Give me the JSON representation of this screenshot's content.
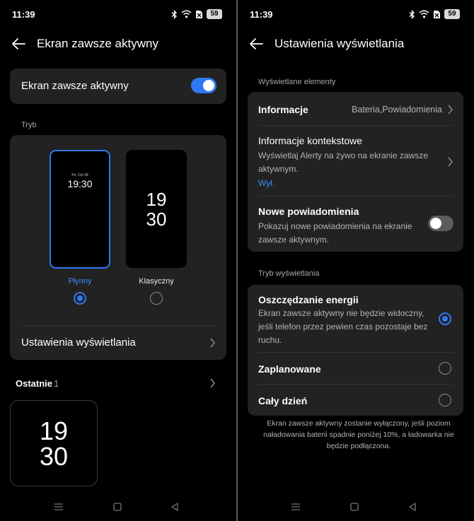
{
  "colors": {
    "accent": "#2f79f2",
    "card": "#222223",
    "background": "#000000",
    "link": "#3d8bf5"
  },
  "left": {
    "status": {
      "time": "11:39",
      "battery": "59"
    },
    "header": {
      "title": "Ekran zawsze aktywny"
    },
    "main_toggle": {
      "label": "Ekran zawsze aktywny",
      "state": "on"
    },
    "mode_section_label": "Tryb",
    "modes": [
      {
        "name": "Płynny",
        "preview_date": "Fri, Oct 28",
        "preview_time": "19:30",
        "selected": true
      },
      {
        "name": "Klasyczny",
        "preview_hour": "19",
        "preview_minute": "30",
        "selected": false
      }
    ],
    "display_settings_label": "Ustawienia wyświetlania",
    "recent": {
      "label": "Ostatnie",
      "count": "1",
      "preview_hour": "19",
      "preview_minute": "30"
    }
  },
  "right": {
    "status": {
      "time": "11:39",
      "battery": "59"
    },
    "header": {
      "title": "Ustawienia wyświetlania"
    },
    "displayed_section_label": "Wyświetlane elementy",
    "info": {
      "title": "Informacje",
      "value": "Bateria,Powiadomienia"
    },
    "contextual": {
      "title": "Informacje kontekstowe",
      "desc": "Wyświetlaj Alerty na żywo na ekranie zawsze aktywnym.",
      "state": "Wył."
    },
    "new_notifications": {
      "title": "Nowe powiadomienia",
      "desc": "Pokazuj nowe powiadomienia na ekranie zawsze aktywnym.",
      "state": "off"
    },
    "display_mode_section_label": "Tryb wyświetlania",
    "modes": [
      {
        "title": "Oszczędzanie energii",
        "desc": "Ekran zawsze aktywny nie będzie widoczny, jeśli telefon przez pewien czas pozostaje bez ruchu.",
        "selected": true
      },
      {
        "title": "Zaplanowane",
        "selected": false
      },
      {
        "title": "Cały dzień",
        "selected": false
      }
    ],
    "footnote": "Ekran zawsze aktywny zostanie wyłączony, jeśli poziom naładowania baterii spadnie poniżej 10%, a ładowarka nie będzie podłączona."
  },
  "icons": [
    "bluetooth-icon",
    "wifi-icon",
    "sim-off-icon",
    "battery-icon",
    "back-arrow-icon",
    "chevron-right-icon",
    "menu-nav-icon",
    "home-nav-icon",
    "back-nav-icon"
  ]
}
